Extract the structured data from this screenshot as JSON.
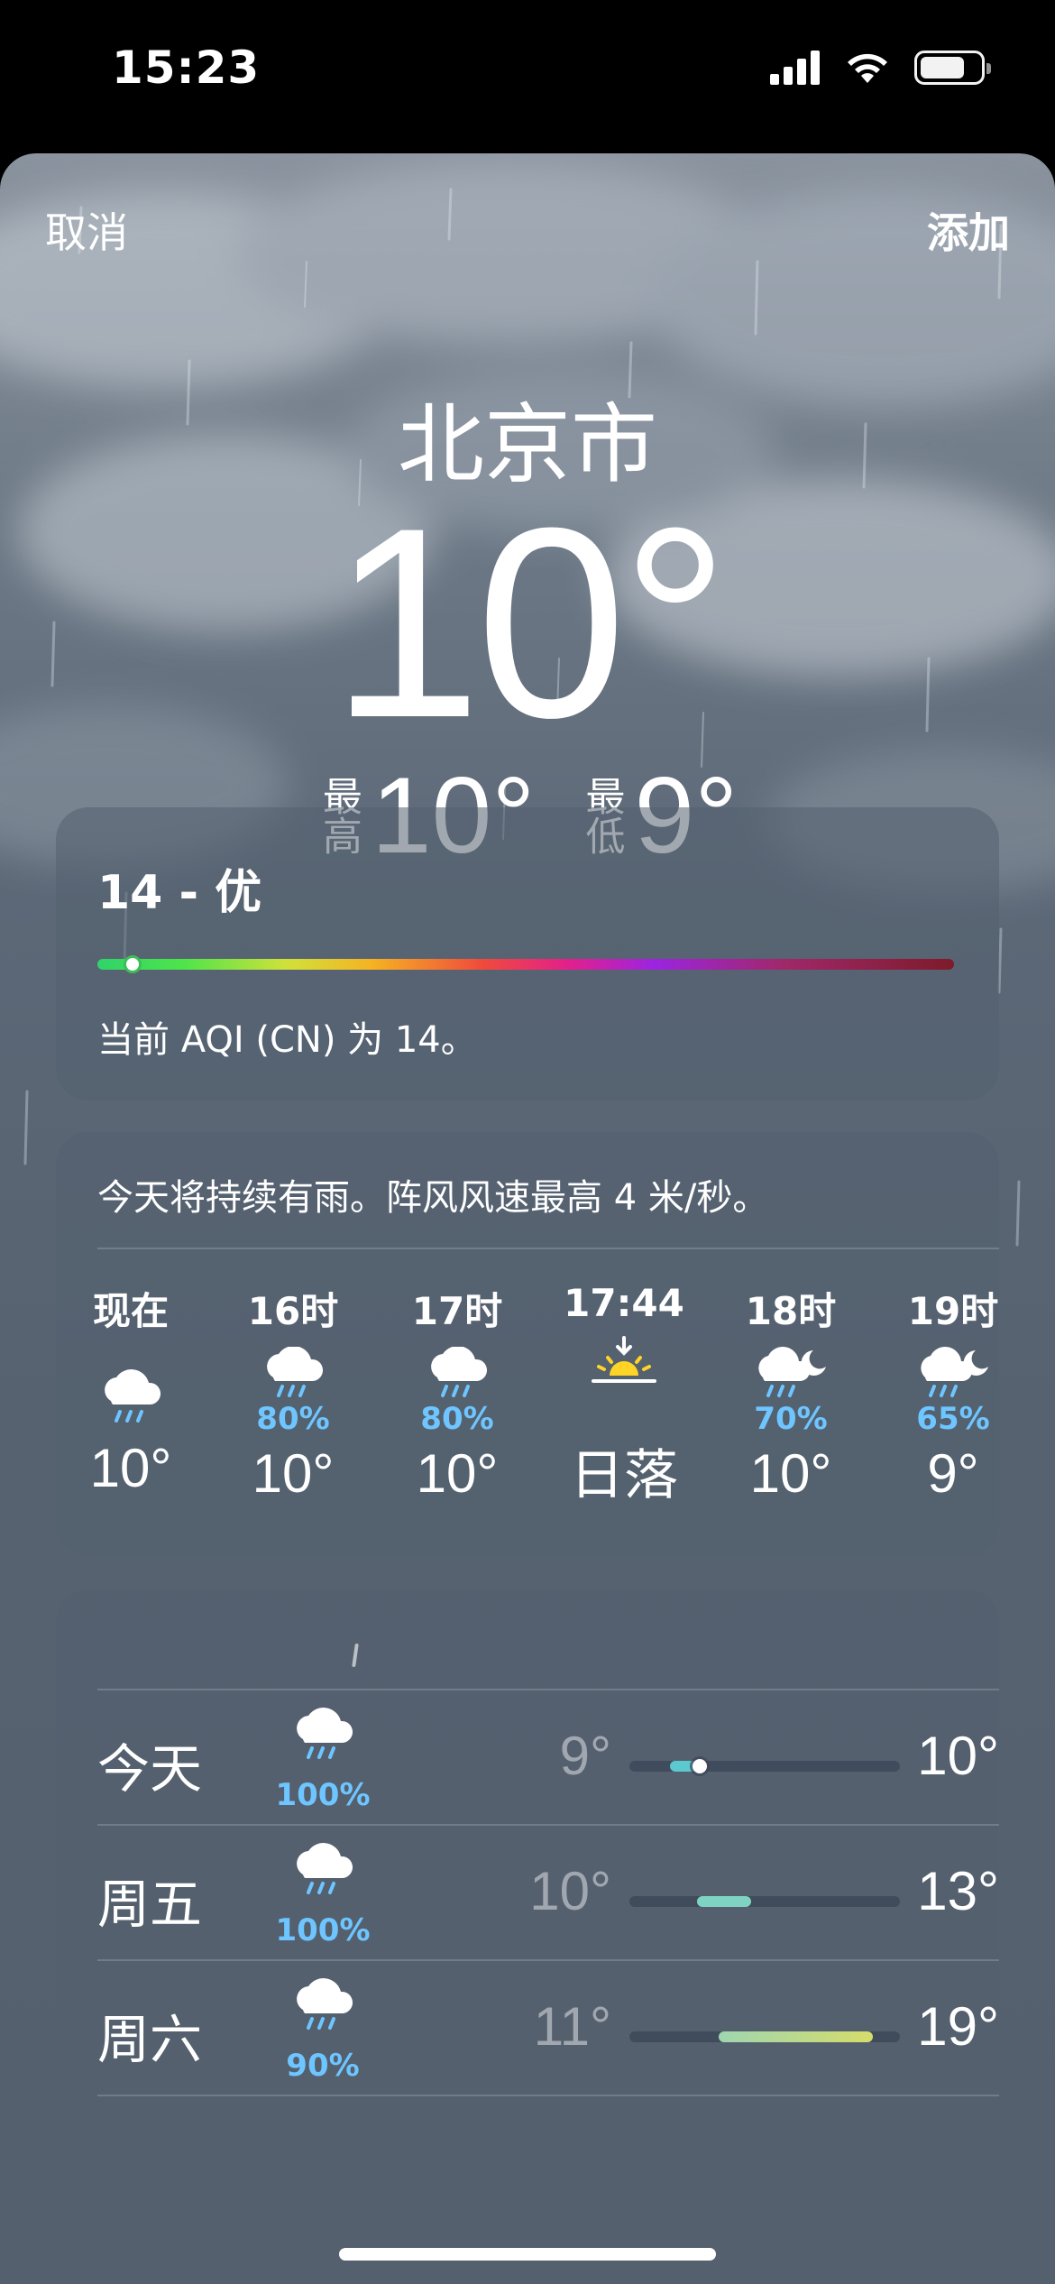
{
  "status_bar": {
    "time": "15:23"
  },
  "nav": {
    "cancel": "取消",
    "add": "添加"
  },
  "current": {
    "city": "北京市",
    "temperature": "10°",
    "high_label": "最高",
    "high": "10°",
    "low_label": "最低",
    "low": "9°"
  },
  "aqi": {
    "title": "14 - 优",
    "description": "当前 AQI (CN) 为 14。",
    "value_fraction": 0.03
  },
  "hourly": {
    "summary": "今天将持续有雨。阵风风速最高 4 米/秒。",
    "items": [
      {
        "label": "现在",
        "icon": "rain-cloud-icon",
        "prob": "",
        "temp": "10°"
      },
      {
        "label": "16时",
        "icon": "rain-cloud-icon",
        "prob": "80%",
        "temp": "10°"
      },
      {
        "label": "17时",
        "icon": "rain-cloud-icon",
        "prob": "80%",
        "temp": "10°"
      },
      {
        "label": "17:44",
        "icon": "sunset-icon",
        "prob": "",
        "temp": "日落"
      },
      {
        "label": "18时",
        "icon": "rain-cloud-moon-icon",
        "prob": "70%",
        "temp": "10°"
      },
      {
        "label": "19时",
        "icon": "rain-cloud-moon-icon",
        "prob": "65%",
        "temp": "9°"
      }
    ]
  },
  "daily": {
    "items": [
      {
        "day": "今天",
        "prob": "100%",
        "low": "9°",
        "high": "10°",
        "range_start": 0.15,
        "range_end": 0.25,
        "colors": "#5cc8d0",
        "current_marker": true
      },
      {
        "day": "周五",
        "prob": "100%",
        "low": "10°",
        "high": "13°",
        "range_start": 0.25,
        "range_end": 0.45,
        "colors": "#7fd3c2",
        "current_marker": false
      },
      {
        "day": "周六",
        "prob": "90%",
        "low": "11°",
        "high": "19°",
        "range_start": 0.33,
        "range_end": 0.9,
        "colors": "#b8d98a",
        "current_marker": false
      }
    ]
  },
  "colors": {
    "precip_blue": "#6ec5ff",
    "sunset_yellow": "#ffd426"
  }
}
